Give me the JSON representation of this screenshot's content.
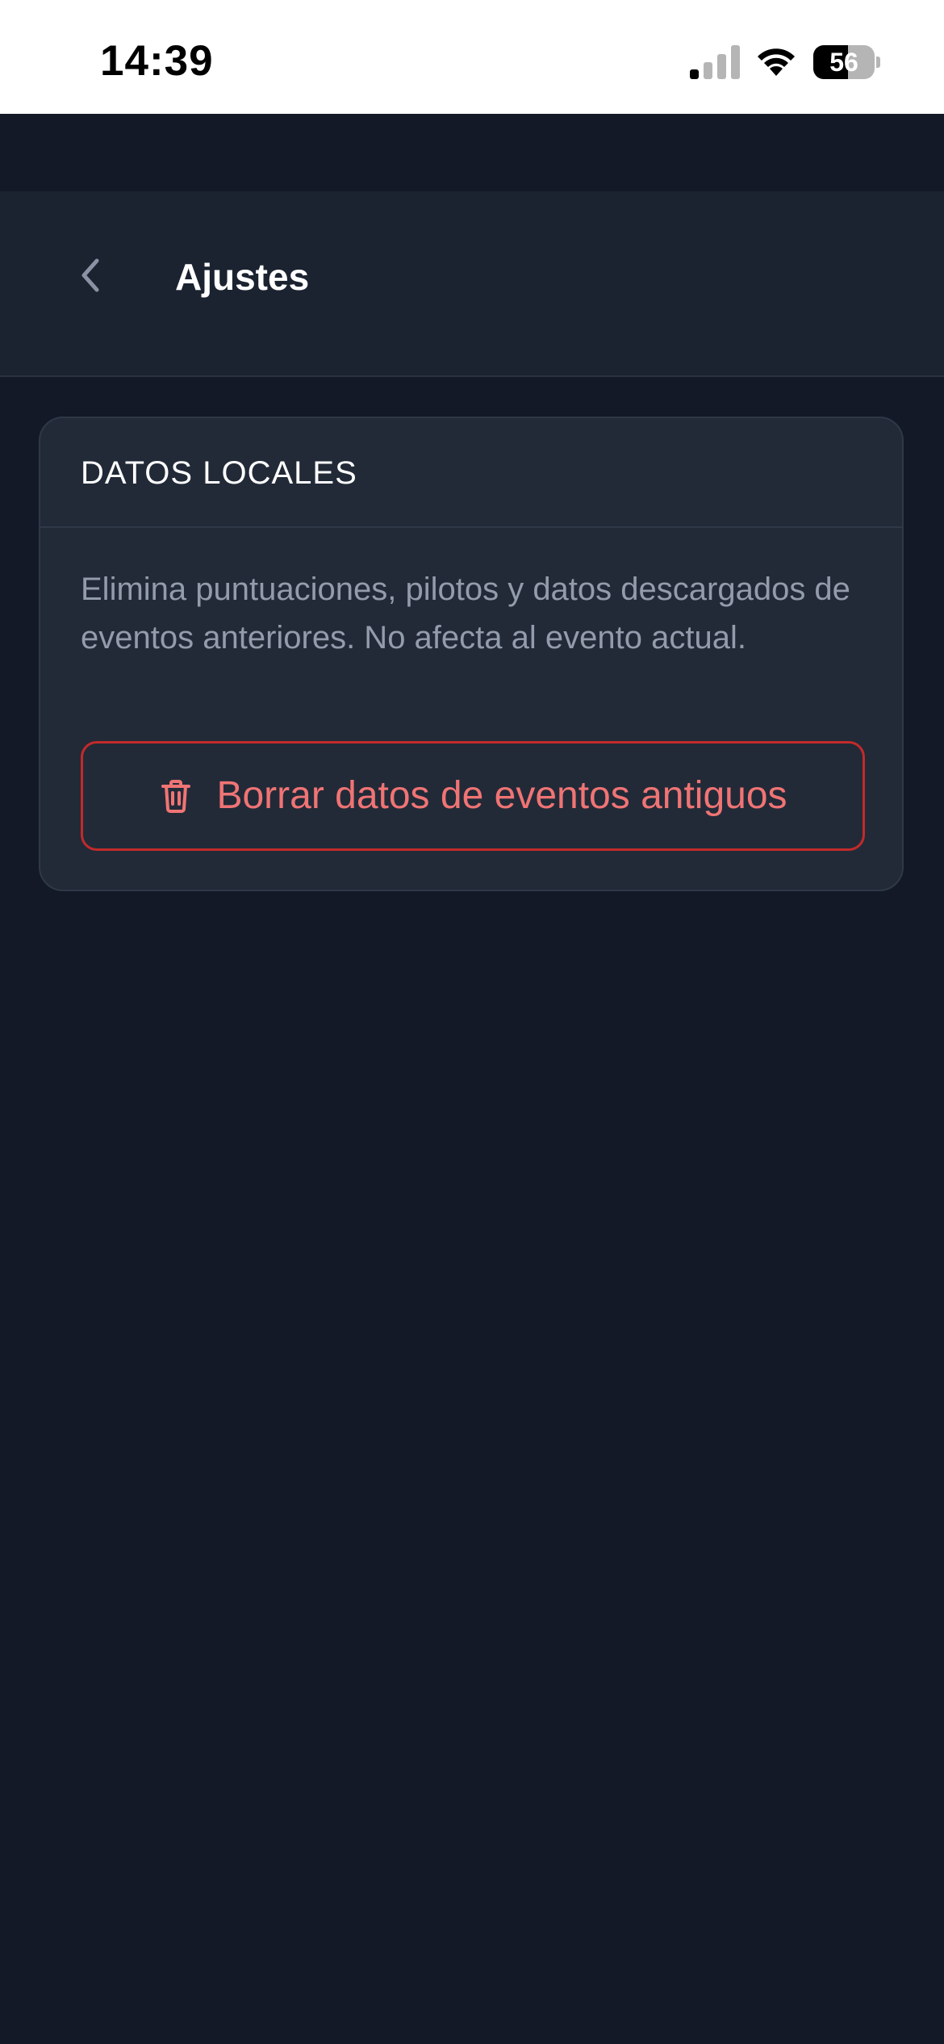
{
  "status_bar": {
    "time": "14:39",
    "battery_level": "56",
    "battery_fraction": 0.56,
    "signal_bars_active": 1,
    "signal_bars_total": 4
  },
  "header": {
    "title": "Ajustes",
    "back_icon": "chevron-left-icon"
  },
  "local_data_card": {
    "title": "DATOS LOCALES",
    "description": "Elimina puntuaciones, pilotos y datos descargados de eventos anteriores. No afecta al evento actual.",
    "delete_button_label": "Borrar datos de eventos antiguos",
    "delete_button_icon": "trash-icon"
  },
  "colors": {
    "background": "#131927",
    "header_background": "#1b2230",
    "card_background": "#222a38",
    "danger": "#c22a2a",
    "danger_text": "#f07474",
    "muted_text": "#939cab"
  }
}
